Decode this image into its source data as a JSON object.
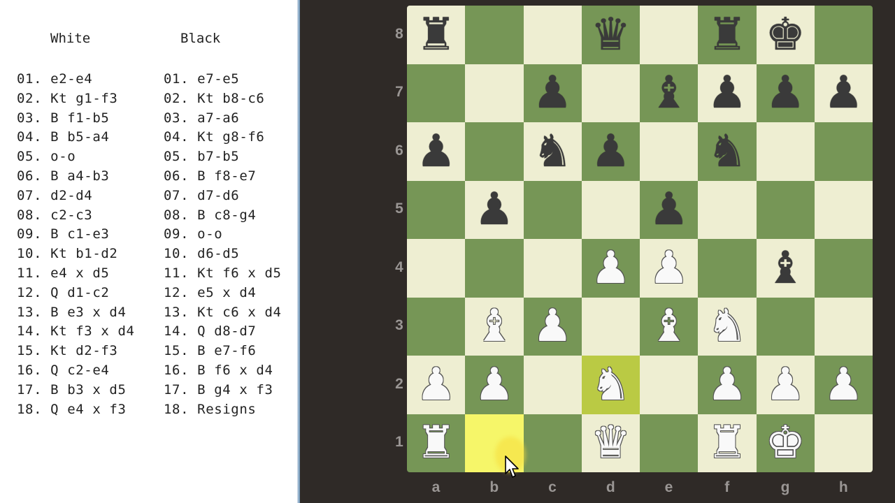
{
  "notes": {
    "white_header": "White",
    "black_header": "Black",
    "white_moves": [
      "01. e2-e4",
      "02. Kt g1-f3",
      "03. B f1-b5",
      "04. B b5-a4",
      "05. o-o",
      "06. B a4-b3",
      "07. d2-d4",
      "08. c2-c3",
      "09. B c1-e3",
      "10. Kt b1-d2",
      "11. e4 x d5",
      "12. Q d1-c2",
      "13. B e3 x d4",
      "14. Kt f3 x d4",
      "15. Kt d2-f3",
      "16. Q c2-e4",
      "17. B b3 x d5",
      "18. Q e4 x f3"
    ],
    "black_moves": [
      "01. e7-e5",
      "02. Kt b8-c6",
      "03. a7-a6",
      "04. Kt g8-f6",
      "05. b7-b5",
      "06. B f8-e7",
      "07. d7-d6",
      "08. B c8-g4",
      "09. o-o",
      "10. d6-d5",
      "11. Kt f6 x d5",
      "12. e5 x d4",
      "13. Kt c6 x d4",
      "14. Q d8-d7",
      "15. B e7-f6",
      "16. B f6 x d4",
      "17. B g4 x f3",
      "18. Resigns"
    ]
  },
  "board": {
    "ranks": [
      "8",
      "7",
      "6",
      "5",
      "4",
      "3",
      "2",
      "1"
    ],
    "files": [
      "a",
      "b",
      "c",
      "d",
      "e",
      "f",
      "g",
      "h"
    ],
    "position": [
      [
        "br",
        "",
        "",
        "bq",
        "",
        "br",
        "bk",
        ""
      ],
      [
        "",
        "",
        "bp",
        "",
        "bb",
        "bp",
        "bp",
        "bp"
      ],
      [
        "bp",
        "",
        "bn",
        "bp",
        "",
        "bn",
        "",
        ""
      ],
      [
        "",
        "bp",
        "",
        "",
        "bp",
        "",
        "",
        ""
      ],
      [
        "",
        "",
        "",
        "wp",
        "wp",
        "",
        "bb",
        ""
      ],
      [
        "",
        "wb",
        "wp",
        "",
        "wb",
        "wn",
        "",
        ""
      ],
      [
        "wp",
        "wp",
        "",
        "wn",
        "",
        "wp",
        "wp",
        "wp"
      ],
      [
        "wr",
        "",
        "",
        "wq",
        "",
        "wr",
        "wk",
        ""
      ]
    ],
    "highlight_to": "d2",
    "highlight_from": "b1",
    "colors": {
      "light": "#eeeed2",
      "dark": "#769656",
      "highlight_to": "#baca44",
      "highlight_from": "#f6f669"
    }
  },
  "piece_glyphs": {
    "k": "♚",
    "q": "♛",
    "r": "♜",
    "b": "♝",
    "n": "♞",
    "p": "♟"
  },
  "piece_names": {
    "k": "king",
    "q": "queen",
    "r": "rook",
    "b": "bishop",
    "n": "knight",
    "p": "pawn"
  }
}
